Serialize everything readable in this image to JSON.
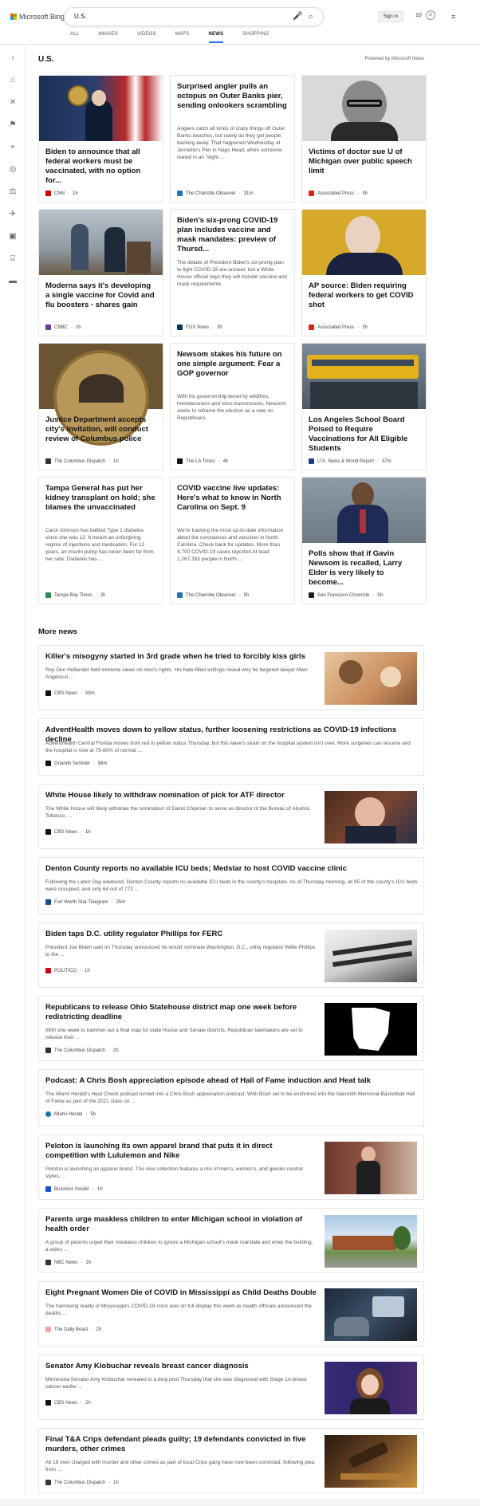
{
  "header": {
    "logo_text": "Microsoft Bing",
    "search_query": "U.S.",
    "sign_in": "Sign in",
    "rewards_count": "10",
    "tabs": [
      {
        "label": "ALL"
      },
      {
        "label": "IMAGES"
      },
      {
        "label": "VIDEOS"
      },
      {
        "label": "MAPS"
      },
      {
        "label": "NEWS"
      },
      {
        "label": "SHOPPING"
      }
    ],
    "active_tab": "NEWS"
  },
  "main": {
    "title": "U.S.",
    "powered_by": "Powered by Microsoft News"
  },
  "top_stories": [
    {
      "title": "Biden to announce that all federal workers must be vaccinated, with no option for...",
      "desc": "",
      "source": "CNN",
      "age": "1h",
      "logo_color": "#cc0000",
      "image": "biden-podium"
    },
    {
      "title": "Surprised angler pulls an octopus on Outer Banks pier, sending onlookers scrambling",
      "desc": "Anglers catch all kinds of crazy things off Outer Banks beaches, but rarely do they get people backing away. That happened Wednesday at Jennette's Pier in Nags Head, when someone reeled in an \"eight ...",
      "source": "The Charlotte Observer",
      "age": "31m",
      "logo_color": "#1b75bb",
      "image": ""
    },
    {
      "title": "Victims of doctor sue U of Michigan over public speech limit",
      "desc": "",
      "source": "Associated Press",
      "age": "3h",
      "logo_color": "#e2231a",
      "image": "portrait-bw"
    },
    {
      "title": "Moderna says it's developing a single vaccine for Covid and flu boosters - shares gain",
      "desc": "",
      "source": "CNBC",
      "age": "2h",
      "logo_color": "#6c3e97",
      "image": "vaccine-clinic"
    },
    {
      "title": "Biden's six-prong COVID-19 plan includes vaccine and mask mandates: preview of Thursd...",
      "desc": "The details of President Biden's six-prong plan to fight COVID-19 are unclear, but a White House official says they will include vaccine and mask requirements.",
      "source": "FOX News",
      "age": "3h",
      "logo_color": "#003366",
      "image": ""
    },
    {
      "title": "AP source: Biden requiring federal workers to get COVID shot",
      "desc": "",
      "source": "Associated Press",
      "age": "3h",
      "logo_color": "#e2231a",
      "image": "biden-yellow"
    },
    {
      "title": "Justice Department accepts city's invitation, will conduct review of Columbus police",
      "desc": "",
      "source": "The Columbus Dispatch",
      "age": "1h",
      "logo_color": "#333333",
      "image": "doj-seal"
    },
    {
      "title": "Newsom stakes his future on one simple argument: Fear a GOP governor",
      "desc": "With his governorship beset by wildfires, homelessness and virus transmission, Newsom seeks to reframe the election as a vote on Republicans.",
      "source": "The LA Times",
      "age": "4h",
      "logo_color": "#111111",
      "image": ""
    },
    {
      "title": "Los Angeles School Board Poised to Require Vaccinations for All Eligible Students",
      "desc": "",
      "source": "U.S. News & World Report",
      "age": "37m",
      "logo_color": "#1d3f8a",
      "image": "school-bus"
    },
    {
      "title": "Tampa General has put her kidney transplant on hold; she blames the unvaccinated",
      "desc": "Carol Johnson has battled Type 1 diabetes since she was 12. It meant an unforgiving regime of injections and medication. For 12 years, an insulin pump has never been far from her side. Diabetes has ...",
      "source": "Tampa Bay Times",
      "age": "2h",
      "logo_color": "#2e8b57",
      "image": ""
    },
    {
      "title": "COVID vaccine live updates: Here's what to know in North Carolina on Sept. 9",
      "desc": "We're tracking the most up-to-date information about the coronavirus and vaccines in North Carolina. Check back for updates. More than 4,700 COVID-19 cases reported At least 1,267,333 people in North ...",
      "source": "The Charlotte Observer",
      "age": "5h",
      "logo_color": "#1b75bb",
      "image": ""
    },
    {
      "title": "Polls show that if Gavin Newsom is recalled, Larry Elder is very likely to become...",
      "desc": "",
      "source": "San Francisco Chronicle",
      "age": "5h",
      "logo_color": "#222222",
      "image": "elder-podium"
    }
  ],
  "more_news": {
    "title": "More news",
    "items": [
      {
        "title": "Killer's misogyny started in 3rd grade when he tried to forcibly kiss girls",
        "desc": "Roy Den Hollander held extreme views on men's rights. His hate-filled writings reveal why he targeted lawyer Marc Angelucci ...",
        "source": "CBS News",
        "age": "59m",
        "logo_color": "#111111",
        "image": "family-photo"
      },
      {
        "title": "AdventHealth moves down to yellow status, further loosening restrictions as COVID-19 infections decline",
        "desc": "AdventHealth Central Florida moves from red to yellow status Thursday, but this wave's strain on the hospital system isn't over. More surgeries can resume and the hospital is now at 75-80% of normal ...",
        "source": "Orlando Sentinel",
        "age": "56m",
        "logo_color": "#111111",
        "image": ""
      },
      {
        "title": "White House likely to withdraw nomination of pick for ATF director",
        "desc": "The White House will likely withdraw the nomination of David Chipman to serve as director of the Bureau of Alcohol, Tobacco, ...",
        "source": "CBS News",
        "age": "1h",
        "logo_color": "#111111",
        "image": "chipman-hearing"
      },
      {
        "title": "Denton County reports no available ICU beds; Medstar to host COVID vaccine clinic",
        "desc": "Following the Labor Day weekend, Denton County reports no available ICU beds in the county's hospitals. As of Thursday morning, all 95 of the county's ICU beds were occupied, and only 64 out of 772 ...",
        "source": "Fort Worth Star-Telegram",
        "age": "25m",
        "logo_color": "#1b4f8c",
        "image": ""
      },
      {
        "title": "Biden taps D.C. utility regulator Phillips for FERC",
        "desc": "President Joe Biden said on Thursday announced he would nominate Washington, D.C., utility regulator Willie Phillips to the ...",
        "source": "POLITICO",
        "age": "1h",
        "logo_color": "#d0021b",
        "image": "ferc-sign"
      },
      {
        "title": "Republicans to release Ohio Statehouse district map one week before redistricting deadline",
        "desc": "With one week to hammer out a final map for state House and Senate districts, Republican lawmakers are set to release their ...",
        "source": "The Columbus Dispatch",
        "age": "2h",
        "logo_color": "#333333",
        "image": "ohio-map"
      },
      {
        "title": "Podcast: A Chris Bosh appreciation episode ahead of Hall of Fame induction and Heat talk",
        "desc": "The Miami Herald's Heat Check podcast turned into a Chris Bosh appreciation podcast. With Bosh set to be enshrined into the Naismith Memorial Basketball Hall of Fame as part of the 2021 class on ...",
        "source": "Miami Herald",
        "age": "5h",
        "logo_color": "#1b75bb",
        "image": ""
      },
      {
        "title": "Peloton is launching its own apparel brand that puts it in direct competition with Lululemon and Nike",
        "desc": "Peloton is launching an apparel brand. The new collection features a mix of men's, women's, and gender-neutral styles, ...",
        "source": "Business Insider",
        "age": "1h",
        "logo_color": "#1b4fd8",
        "image": "peloton-model"
      },
      {
        "title": "Parents urge maskless children to enter Michigan school in violation of health order",
        "desc": "A group of parents urged their maskless children to ignore a Michigan school's mask mandate and enter the building, a video ...",
        "source": "NBC News",
        "age": "1h",
        "logo_color": "#333333",
        "image": "school-building"
      },
      {
        "title": "Eight Pregnant Women Die of COVID in Mississippi as Child Deaths Double",
        "desc": "The harrowing reality of Mississippi's COVID-19 crisis was on full display this week as health officials announced the deaths ...",
        "source": "The Daily Beast",
        "age": "2h",
        "logo_color": "#f4a6a6",
        "image": "hospital-room"
      },
      {
        "title": "Senator Amy Klobuchar reveals breast cancer diagnosis",
        "desc": "Minnesota Senator Amy Klobuchar revealed in a blog post Thursday that she was diagnosed with Stage 1A breast cancer earlier ...",
        "source": "CBS News",
        "age": "2h",
        "logo_color": "#111111",
        "image": "klobuchar"
      },
      {
        "title": "Final T&A Crips defendant pleads guilty; 19 defendants convicted in five murders, other crimes",
        "desc": "All 19 men charged with murder and other crimes as part of local Crips gang have now been convicted, following plea from ...",
        "source": "The Columbus Dispatch",
        "age": "1h",
        "logo_color": "#333333",
        "image": "gavel"
      }
    ]
  }
}
